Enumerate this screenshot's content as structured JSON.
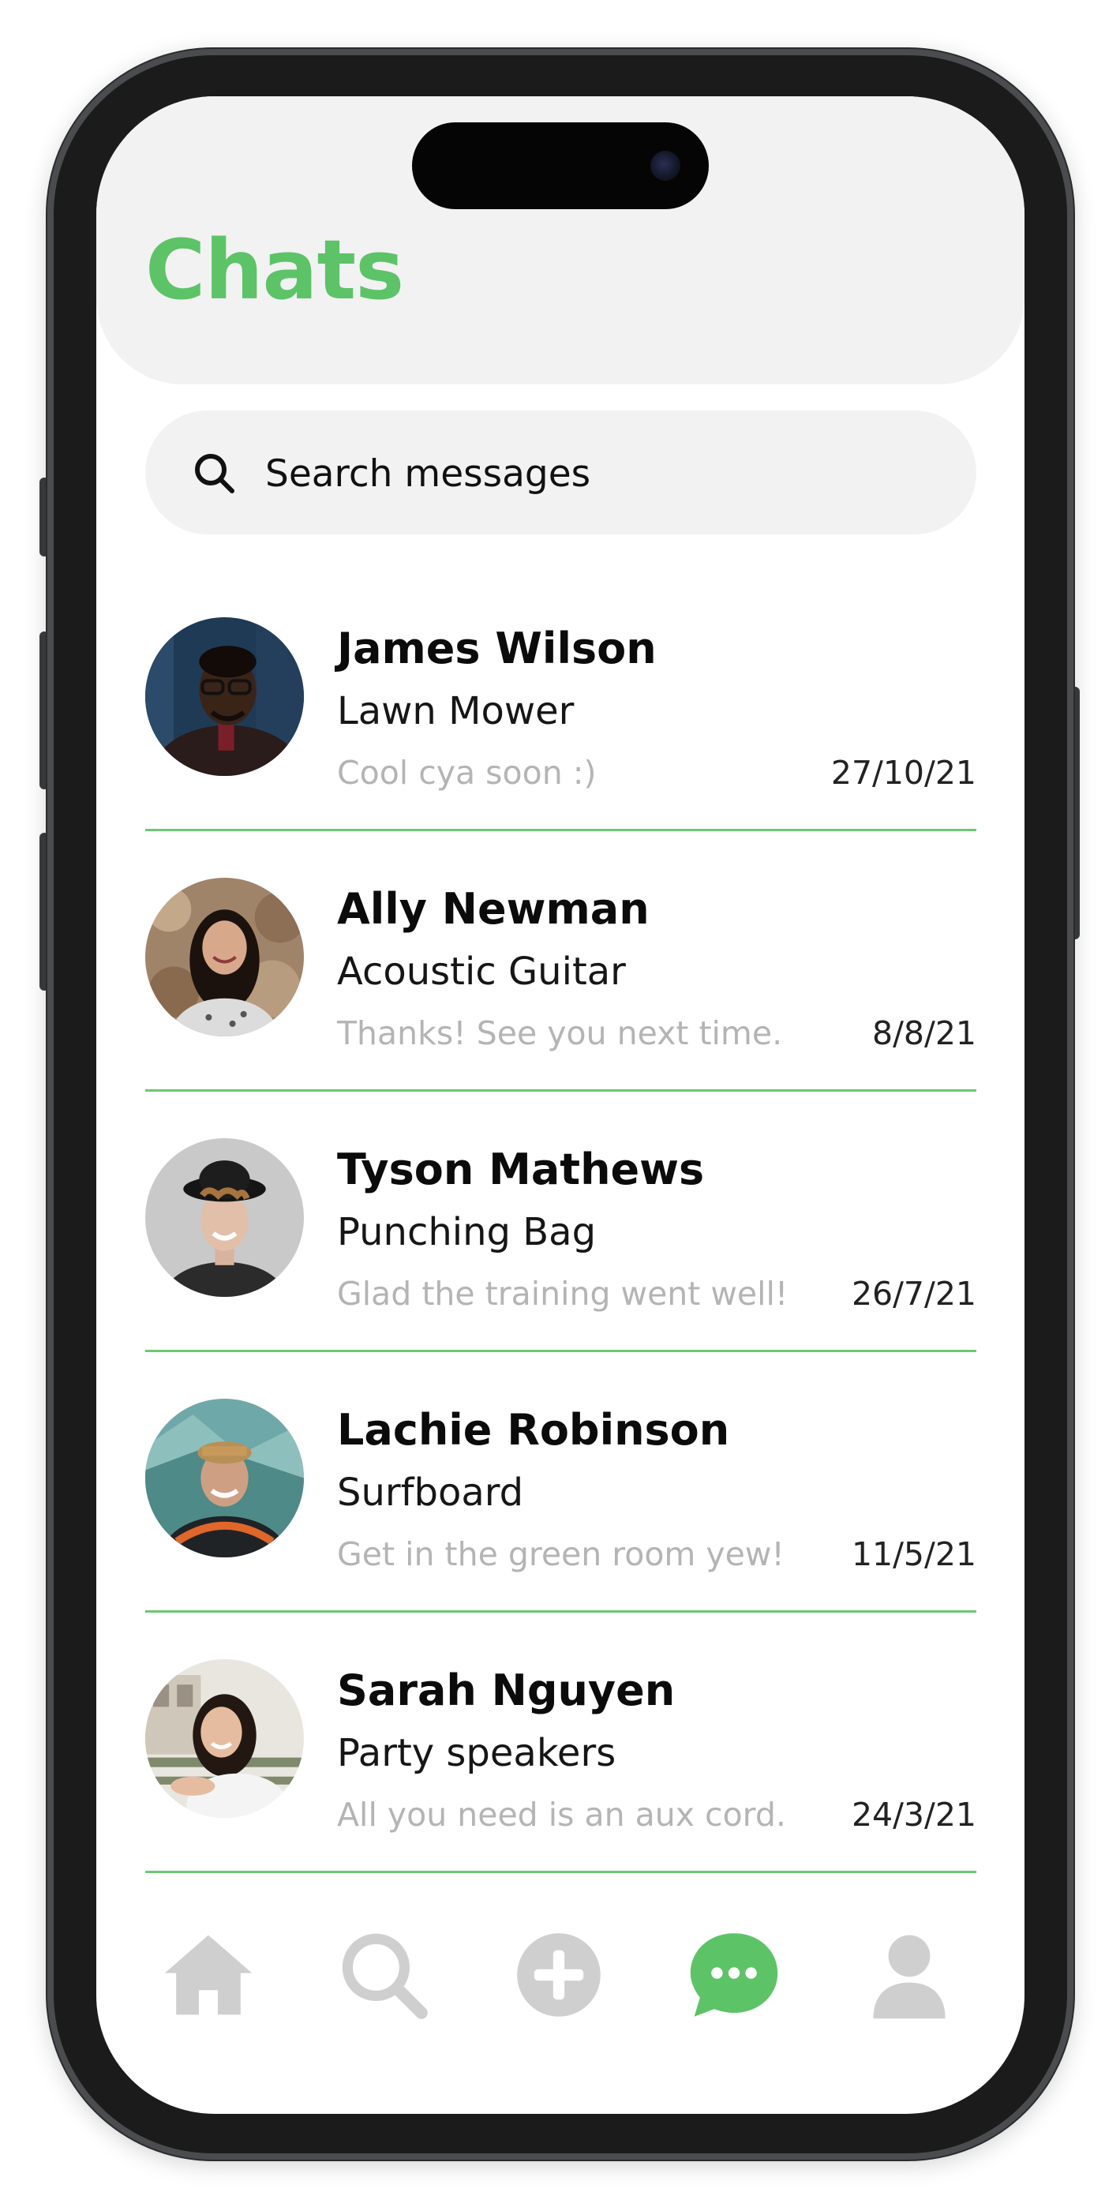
{
  "header": {
    "title": "Chats"
  },
  "search": {
    "placeholder": "Search messages"
  },
  "chats": [
    {
      "name": "James Wilson",
      "item": "Lawn Mower",
      "preview": "Cool cya soon :)",
      "date": "27/10/21"
    },
    {
      "name": "Ally Newman",
      "item": "Acoustic Guitar",
      "preview": "Thanks! See you next time.",
      "date": "8/8/21"
    },
    {
      "name": "Tyson Mathews",
      "item": "Punching Bag",
      "preview": "Glad the training went well!",
      "date": "26/7/21"
    },
    {
      "name": "Lachie Robinson",
      "item": "Surfboard",
      "preview": "Get in the green room yew!",
      "date": "11/5/21"
    },
    {
      "name": "Sarah Nguyen",
      "item": "Party speakers",
      "preview": "All you need is an aux cord.",
      "date": "24/3/21"
    }
  ],
  "bottom_nav": {
    "items": [
      {
        "icon": "home-icon",
        "active": false
      },
      {
        "icon": "search-icon",
        "active": false
      },
      {
        "icon": "add-icon",
        "active": false
      },
      {
        "icon": "chat-icon",
        "active": true
      },
      {
        "icon": "profile-icon",
        "active": false
      }
    ]
  },
  "colors": {
    "accent": "#5dc367",
    "divider": "#6cc873",
    "inactive_icon": "#cfcfcf",
    "header_bg": "#f2f2f2"
  }
}
